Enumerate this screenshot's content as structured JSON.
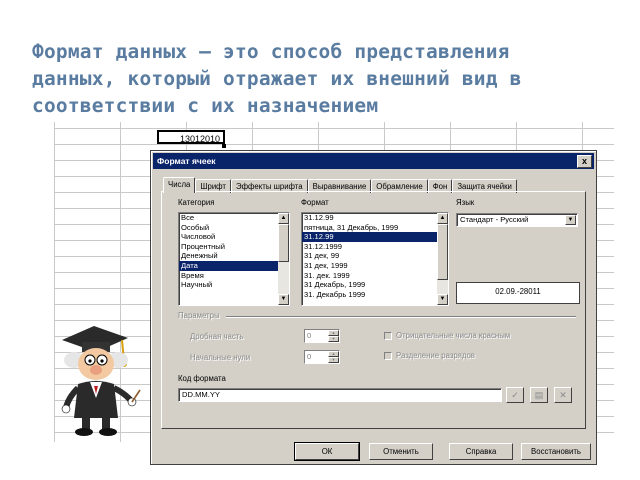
{
  "heading": {
    "line1": "Формат данных – это способ представления",
    "line2": "данных, который отражает их внешний вид в",
    "line3": "соответствии с их назначением"
  },
  "spreadsheet": {
    "cell_value": "13012010"
  },
  "dialog": {
    "title": "Формат ячеек",
    "close_label": "x",
    "tabs": [
      {
        "label": "Числа",
        "active": true
      },
      {
        "label": "Шрифт",
        "active": false
      },
      {
        "label": "Эффекты шрифта",
        "active": false
      },
      {
        "label": "Выравнивание",
        "active": false
      },
      {
        "label": "Обрамление",
        "active": false
      },
      {
        "label": "Фон",
        "active": false
      },
      {
        "label": "Защита ячейки",
        "active": false
      }
    ],
    "category": {
      "label": "Категория",
      "items": [
        "Все",
        "Особый",
        "Числовой",
        "Процентный",
        "Денежный",
        "Дата",
        "Время",
        "Научный"
      ],
      "selected_index": 5
    },
    "format": {
      "label": "Формат",
      "items": [
        "31.12.99",
        "пятница, 31 Декабрь, 1999",
        "31.12.99",
        "31.12.1999",
        "31 дек, 99",
        "31 дек, 1999",
        "31. дек. 1999",
        "31 Декабрь, 1999",
        "31. Декабрь 1999"
      ],
      "selected_index": 2
    },
    "language": {
      "label": "Язык",
      "value": "Стандарт - Русский"
    },
    "preview_value": "02.09.-28011",
    "options": {
      "group_label": "Параметры",
      "decimal_label": "Дробная часть",
      "decimal_value": "0",
      "leading_zeros_label": "Начальные нули",
      "leading_zeros_value": "0",
      "negative_red_label": "Отрицательные числа красным",
      "thousands_sep_label": "Разделение разрядов"
    },
    "format_code": {
      "label": "Код формата",
      "value": "DD.MM.YY"
    },
    "icons": [
      "checkmark-icon",
      "comment-icon",
      "delete-icon"
    ],
    "buttons": {
      "ok": "ОК",
      "cancel": "Отменить",
      "help": "Справка",
      "reset": "Восстановить"
    }
  },
  "colors": {
    "heading": "#5a7ca0",
    "titlebar": "#0a246a",
    "dialog_bg": "#d4d0c8",
    "selection": "#0a246a"
  }
}
